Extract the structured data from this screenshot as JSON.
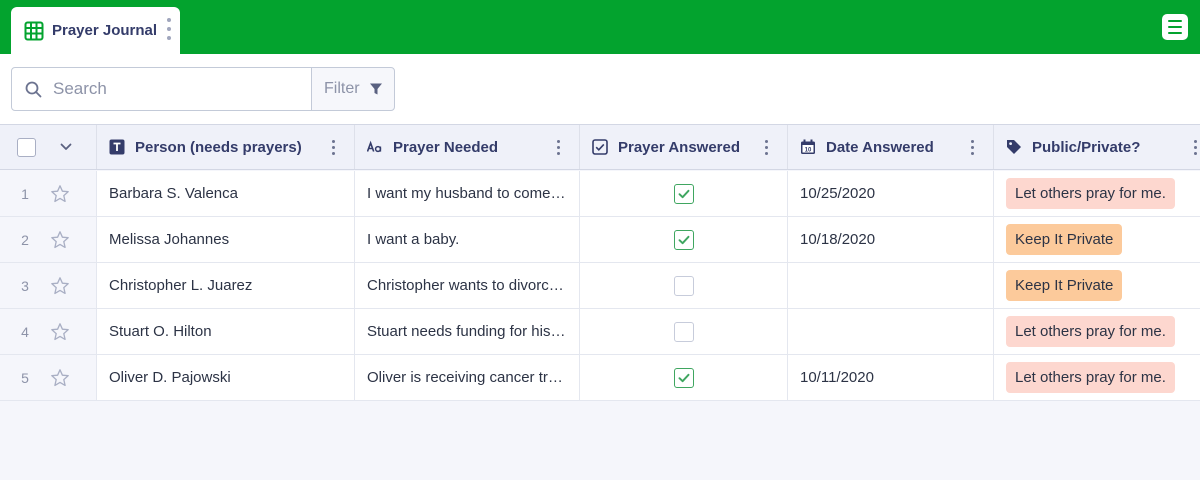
{
  "tab": {
    "label": "Prayer Journal"
  },
  "search": {
    "placeholder": "Search"
  },
  "filter": {
    "label": "Filter"
  },
  "columns": [
    {
      "label": "Person (needs prayers)",
      "icon": "text-type-icon"
    },
    {
      "label": "Prayer Needed",
      "icon": "aa-text-icon"
    },
    {
      "label": "Prayer Answered",
      "icon": "checkbox-icon"
    },
    {
      "label": "Date Answered",
      "icon": "calendar-icon"
    },
    {
      "label": "Public/Private?",
      "icon": "tag-icon"
    }
  ],
  "rows": [
    {
      "num": "1",
      "person": "Barbara S. Valenca",
      "prayer": "I want my husband to come back home.",
      "answered": true,
      "date": "10/25/2020",
      "privacy": "Let others pray for me.",
      "privacy_color": "#fdd7cf"
    },
    {
      "num": "2",
      "person": "Melissa Johannes",
      "prayer": "I want a baby.",
      "answered": true,
      "date": "10/18/2020",
      "privacy": "Keep It Private",
      "privacy_color": "#fcca9b"
    },
    {
      "num": "3",
      "person": "Christopher L. Juarez",
      "prayer": "Christopher wants to divorce his wife.",
      "answered": false,
      "date": "",
      "privacy": "Keep It Private",
      "privacy_color": "#fcca9b"
    },
    {
      "num": "4",
      "person": "Stuart O. Hilton",
      "prayer": "Stuart needs funding for his business.",
      "answered": false,
      "date": "",
      "privacy": "Let others pray for me.",
      "privacy_color": "#fdd7cf"
    },
    {
      "num": "5",
      "person": "Oliver D. Pajowski",
      "prayer": "Oliver is receiving cancer treatment.",
      "answered": true,
      "date": "10/11/2020",
      "privacy": "Let others pray for me.",
      "privacy_color": "#fdd7cf"
    }
  ],
  "colors": {
    "brand_green": "#03a32e",
    "check_green": "#3fa660"
  }
}
